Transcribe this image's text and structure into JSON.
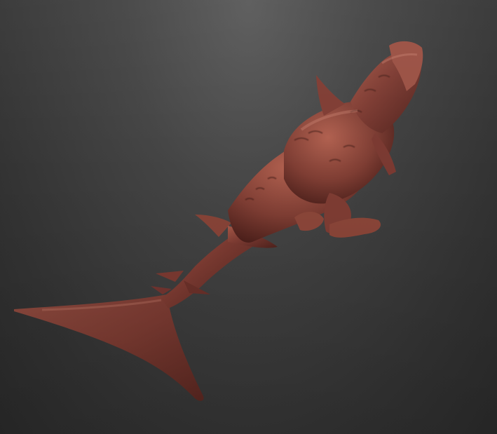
{
  "viewport": {
    "background_top": "#5a5a5a",
    "background_bottom": "#2a2a2a"
  },
  "model": {
    "material_color": "#7a3a32",
    "highlight_color": "#a8564a",
    "shadow_color": "#4a1f1a"
  }
}
